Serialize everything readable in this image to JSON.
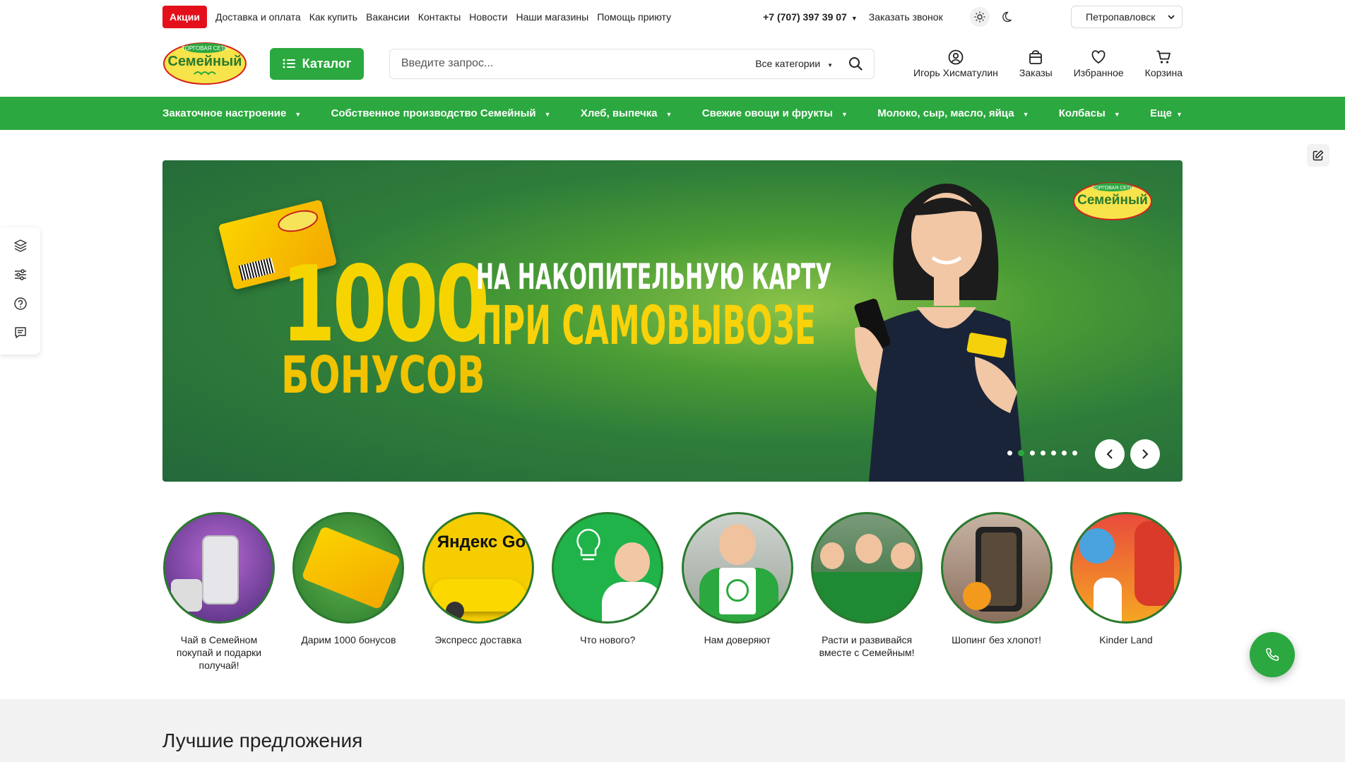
{
  "topbar": {
    "promo": "Акции",
    "links": [
      "Доставка и оплата",
      "Как купить",
      "Вакансии",
      "Контакты",
      "Новости",
      "Наши магазины",
      "Помощь приюту"
    ],
    "phone": "+7 (707) 397 39 07",
    "callback": "Заказать звонок",
    "city": "Петропавловск"
  },
  "header": {
    "logo_top": "ТОРГОВАЯ СЕТЬ",
    "logo_name": "Семейный",
    "catalog": "Каталог",
    "search_placeholder": "Введите запрос...",
    "search_category": "Все категории",
    "user": "Игорь Хисматулин",
    "orders": "Заказы",
    "favorites": "Избранное",
    "cart": "Корзина"
  },
  "nav": [
    "Закаточное настроение",
    "Собственное производство Семейный",
    "Хлеб, выпечка",
    "Свежие овощи и фрукты",
    "Молоко, сыр, масло, яйца",
    "Колбасы",
    "Еще"
  ],
  "banner": {
    "number": "1000",
    "bonus": "БОНУСОВ",
    "line1": "НА НАКОПИТЕЛЬНУЮ КАРТУ",
    "line2": "ПРИ САМОВЫВОЗЕ",
    "slides": 7,
    "active_slide": 2
  },
  "stories": [
    "Чай в Семейном покупай и подарки получай!",
    "Дарим 1000 бонусов",
    "Экспресс доставка",
    "Что нового?",
    "Нам доверяют",
    "Расти и развивайся вместе с Семейным!",
    "Шопинг без хлопот!",
    "Kinder Land"
  ],
  "story_badge": "Яндекс Go",
  "section_title": "Лучшие предложения",
  "colors": {
    "brand_green": "#2ba83f",
    "promo_red": "#e3101b",
    "story_border": "#2a7a2e"
  }
}
